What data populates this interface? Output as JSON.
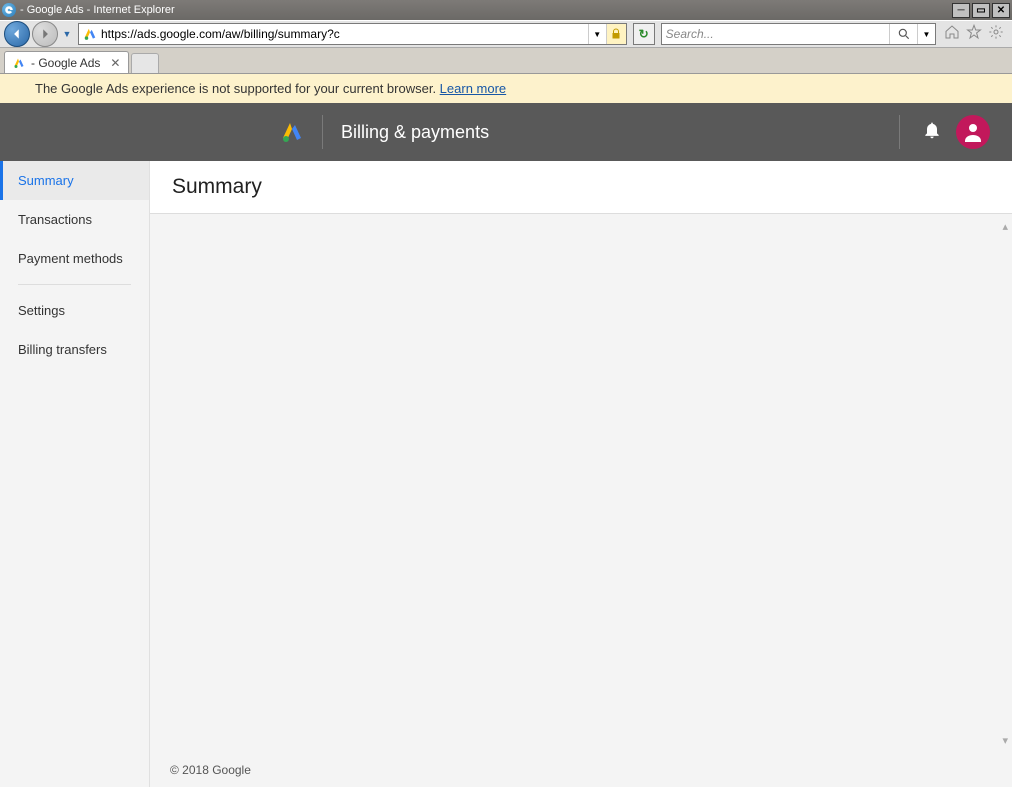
{
  "window": {
    "title": "- Google Ads - Internet Explorer"
  },
  "address": {
    "url": "https://ads.google.com/aw/billing/summary?c",
    "search_placeholder": "Search..."
  },
  "tab": {
    "title": " - Google Ads"
  },
  "banner": {
    "text": "The Google Ads experience is not supported for your current browser. ",
    "link": "Learn more"
  },
  "toolbar": {
    "title": "Billing & payments"
  },
  "sidebar": {
    "items": [
      {
        "label": "Summary",
        "active": true
      },
      {
        "label": "Transactions"
      },
      {
        "label": "Payment methods"
      },
      {
        "label": "Settings",
        "divider_before": true
      },
      {
        "label": "Billing transfers"
      }
    ]
  },
  "main": {
    "heading": "Summary"
  },
  "footer": {
    "copyright": "© 2018 Google"
  }
}
